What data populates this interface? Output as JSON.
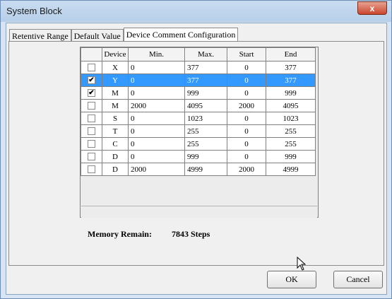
{
  "window": {
    "title": "System Block",
    "close_label": "x"
  },
  "tabs": [
    "Retentive Range",
    "Default Value",
    "Device Comment Configuration"
  ],
  "table": {
    "headers": [
      "",
      "Device",
      "Min.",
      "Max.",
      "Start",
      "End"
    ],
    "rows": [
      {
        "checked": false,
        "selected": false,
        "device": "X",
        "min": "0",
        "max": "377",
        "start": "0",
        "end": "377"
      },
      {
        "checked": true,
        "selected": true,
        "device": "Y",
        "min": "0",
        "max": "377",
        "start": "0",
        "end": "377"
      },
      {
        "checked": true,
        "selected": false,
        "device": "M",
        "min": "0",
        "max": "999",
        "start": "0",
        "end": "999"
      },
      {
        "checked": false,
        "selected": false,
        "device": "M",
        "min": "2000",
        "max": "4095",
        "start": "2000",
        "end": "4095"
      },
      {
        "checked": false,
        "selected": false,
        "device": "S",
        "min": "0",
        "max": "1023",
        "start": "0",
        "end": "1023"
      },
      {
        "checked": false,
        "selected": false,
        "device": "T",
        "min": "0",
        "max": "255",
        "start": "0",
        "end": "255"
      },
      {
        "checked": false,
        "selected": false,
        "device": "C",
        "min": "0",
        "max": "255",
        "start": "0",
        "end": "255"
      },
      {
        "checked": false,
        "selected": false,
        "device": "D",
        "min": "0",
        "max": "999",
        "start": "0",
        "end": "999"
      },
      {
        "checked": false,
        "selected": false,
        "device": "D",
        "min": "2000",
        "max": "4999",
        "start": "2000",
        "end": "4999"
      }
    ]
  },
  "memory": {
    "label": "Memory Remain:",
    "value": "7843 Steps"
  },
  "buttons": {
    "ok": "OK",
    "cancel": "Cancel"
  },
  "colors": {
    "selection": "#3399ff",
    "title_bar": "#c9dcf1",
    "close_button": "#c9462f"
  },
  "icons": {
    "cursor": "mouse-pointer-icon",
    "check": "checkmark-icon"
  }
}
